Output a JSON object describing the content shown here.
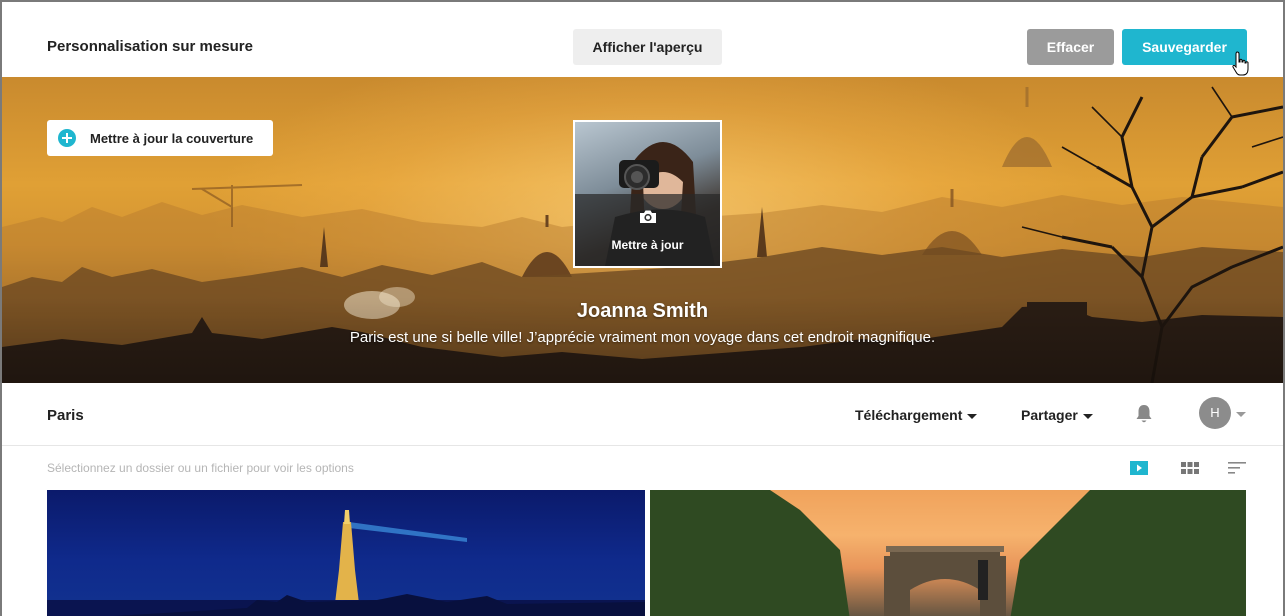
{
  "topbar": {
    "title": "Personnalisation sur mesure",
    "preview_label": "Afficher l'aperçu",
    "clear_label": "Effacer",
    "save_label": "Sauvegarder"
  },
  "cover": {
    "update_cover_label": "Mettre à jour la couverture",
    "avatar_update_label": "Mettre à jour"
  },
  "profile": {
    "name": "Joanna Smith",
    "bio": "Paris est une si belle ville! J’apprécie vraiment mon voyage dans cet endroit magnifique."
  },
  "folderbar": {
    "title": "Paris",
    "download_label": "Téléchargement",
    "share_label": "Partager",
    "user_initial": "H"
  },
  "hint": "Sélectionnez un dossier ou un fichier pour voir les options",
  "colors": {
    "accent": "#1fb6cf",
    "clear_button": "#9b9b9b",
    "preview_button": "#eeeeee"
  },
  "icons": [
    "plus-circle-icon",
    "camera-icon",
    "caret-down-icon",
    "bell-icon",
    "slideshow-icon",
    "grid-icon",
    "sort-icon",
    "hand-cursor-icon"
  ]
}
